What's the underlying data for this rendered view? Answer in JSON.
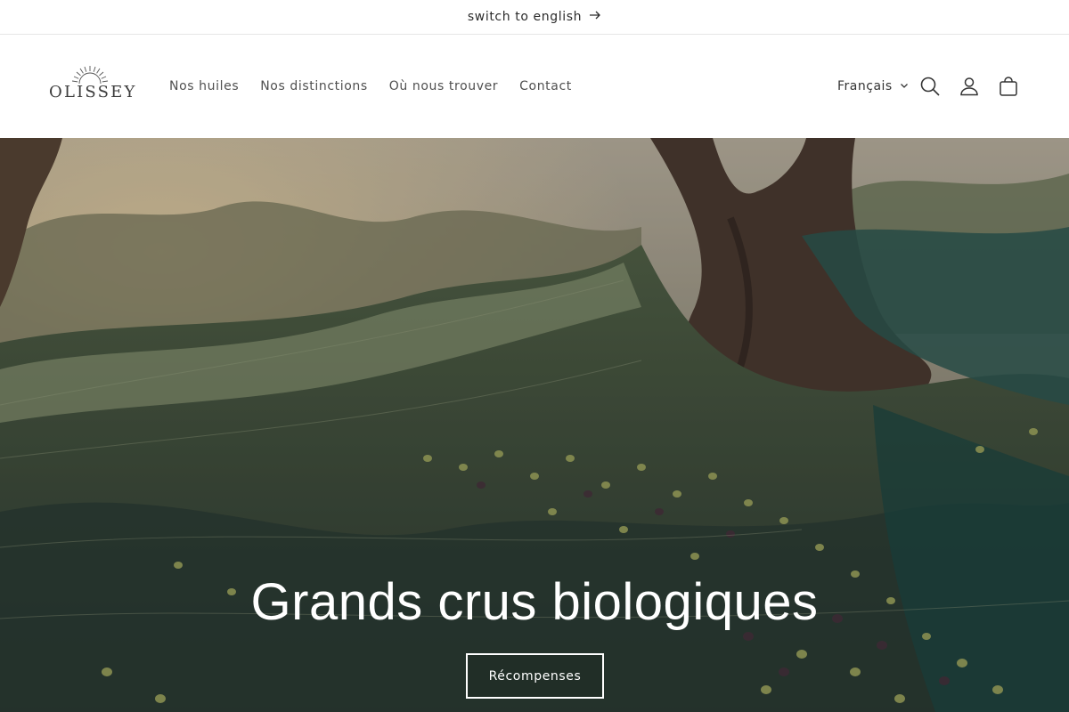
{
  "announcement": {
    "text": "switch to english",
    "icon": "arrow-right-icon"
  },
  "header": {
    "logo_text": "OLISSEY",
    "nav": [
      {
        "label": "Nos huiles"
      },
      {
        "label": "Nos distinctions"
      },
      {
        "label": "Où nous trouver"
      },
      {
        "label": "Contact"
      }
    ],
    "language": "Français",
    "icons": [
      "search-icon",
      "account-icon",
      "cart-icon"
    ]
  },
  "hero": {
    "title": "Grands crus biologiques",
    "button_label": "Récompenses"
  },
  "colors": {
    "text": "#3a3a3a",
    "hero_text": "#ffffff",
    "border": "#e6e6e6"
  }
}
